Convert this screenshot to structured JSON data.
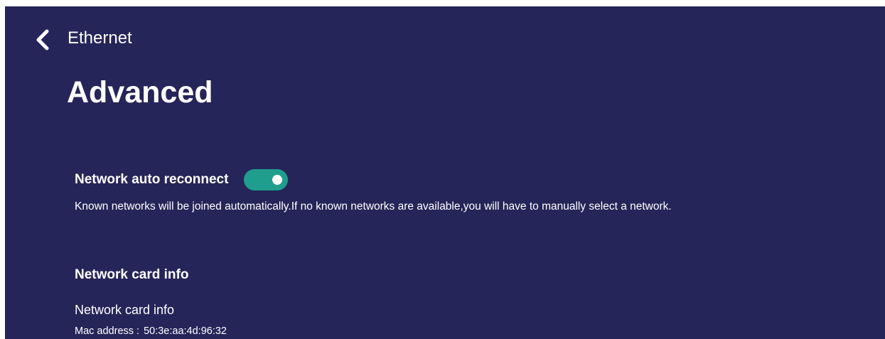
{
  "header": {
    "back_icon": "chevron-left-icon",
    "nav_title": "Ethernet"
  },
  "page": {
    "title": "Advanced"
  },
  "settings": {
    "auto_reconnect": {
      "label": "Network auto reconnect",
      "enabled": true,
      "description": "Known networks will be joined automatically.If no known networks are available,you will have to manually select a network."
    }
  },
  "network_card": {
    "section_title": "Network card info",
    "label": "Network card info",
    "mac_label": "Mac address :",
    "mac_value": "50:3e:aa:4d:96:32"
  },
  "colors": {
    "background": "#262559",
    "toggle_on": "#1f9e8e",
    "text": "#ffffff"
  }
}
